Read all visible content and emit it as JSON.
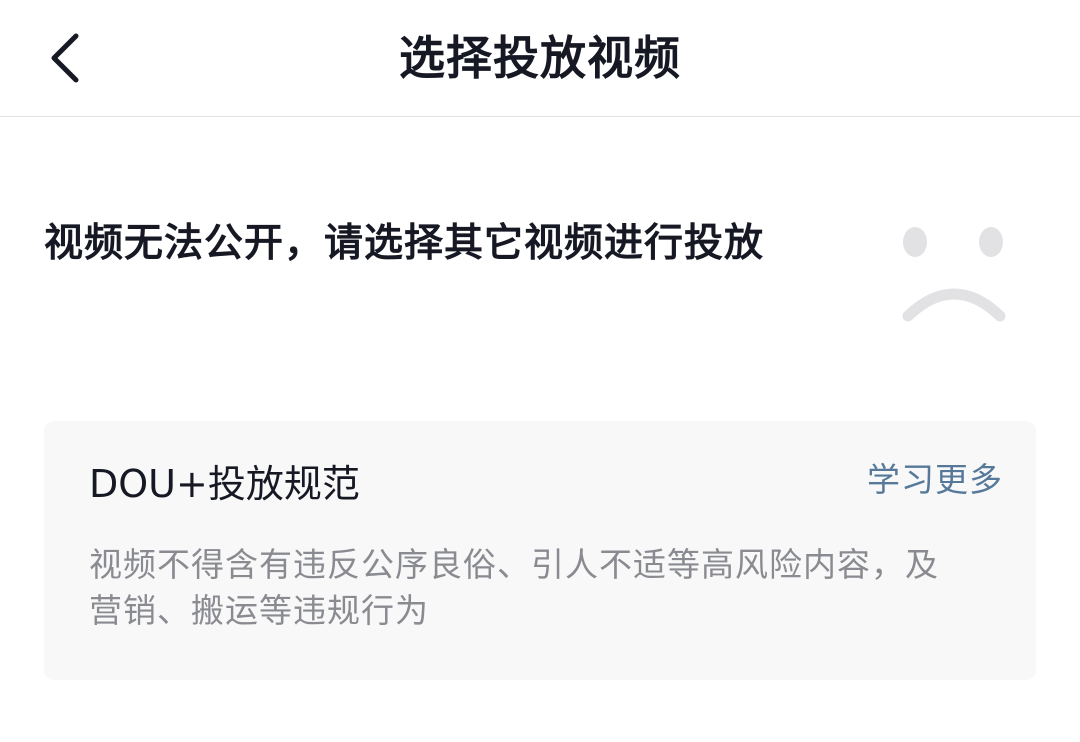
{
  "header": {
    "title": "选择投放视频",
    "back_icon": "chevron-left-icon"
  },
  "message": {
    "text": "视频无法公开，请选择其它视频进行投放",
    "illustration_icon": "sad-face-icon"
  },
  "guideline_card": {
    "title": "DOU+投放规范",
    "learn_more_label": "学习更多",
    "description": "视频不得含有违反公序良俗、引人不适等高风险内容，及营销、搬运等违规行为"
  },
  "colors": {
    "text_primary": "#161823",
    "text_secondary": "#8a8b91",
    "link": "#56799a",
    "card_bg": "#f8f8f8",
    "icon_gray": "#e2e2e4",
    "divider": "#e3e3e5"
  }
}
